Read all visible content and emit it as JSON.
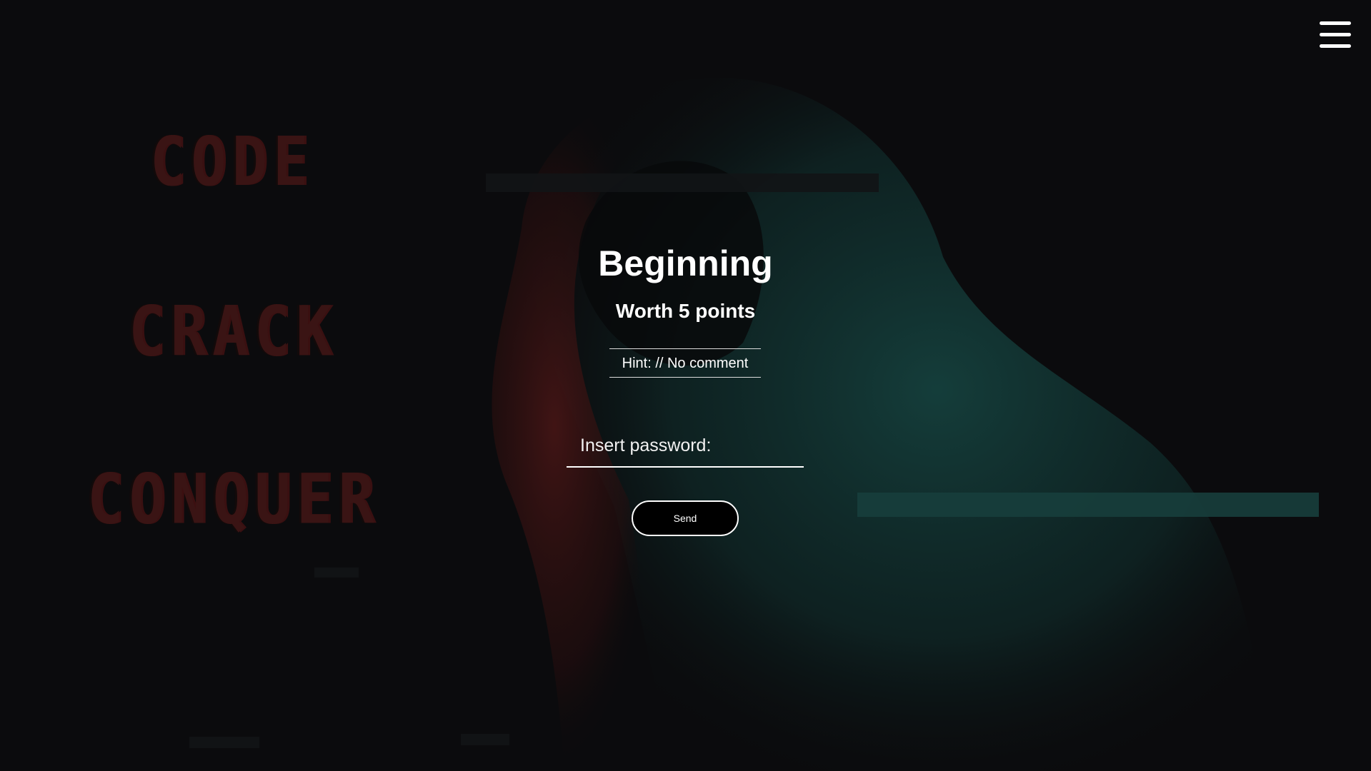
{
  "left_words": [
    "CODE",
    "CRACK",
    "CONQUER"
  ],
  "menu": {
    "icon": "hamburger-menu-icon"
  },
  "challenge": {
    "title": "Beginning",
    "worth": "Worth 5 points",
    "hint": "Hint: // No comment"
  },
  "form": {
    "password_placeholder": "Insert password:",
    "password_value": "",
    "send_label": "Send"
  },
  "colors": {
    "background": "#0b0b0d",
    "word_red": "#3a1414",
    "figure_teal": "#123a38",
    "figure_red": "#4a1515",
    "text": "#ffffff"
  }
}
